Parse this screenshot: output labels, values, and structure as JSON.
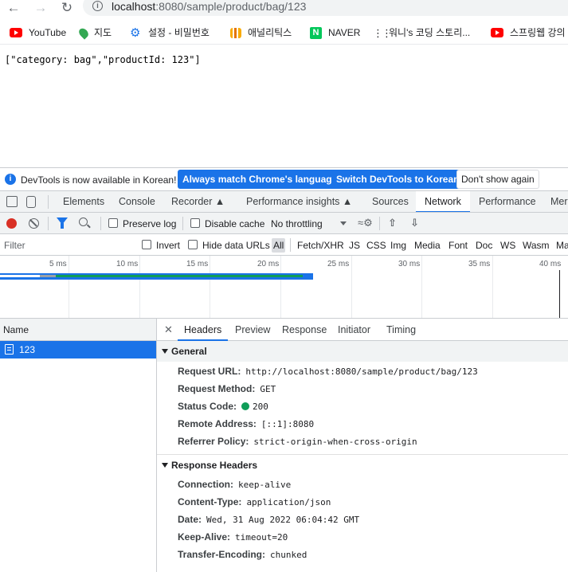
{
  "browser": {
    "url_host": "localhost",
    "url_path": ":8080/sample/product/bag/123"
  },
  "bookmarks": [
    {
      "label": "YouTube",
      "icon": "youtube-icon"
    },
    {
      "label": "지도",
      "icon": "maps-pin-icon"
    },
    {
      "label": "설정 - 비밀번호",
      "icon": "gear-icon"
    },
    {
      "label": "애널리틱스",
      "icon": "analytics-icon"
    },
    {
      "label": "NAVER",
      "icon": "naver-icon"
    },
    {
      "label": "워니's 코딩 스토리...",
      "icon": "dots-icon"
    },
    {
      "label": "스프링웹 강의",
      "icon": "youtube-icon"
    }
  ],
  "page": {
    "json_output": "[\"category: bag\",\"productId: 123\"]"
  },
  "devtools": {
    "infobar": {
      "message": "DevTools is now available in Korean!",
      "btn_match": "Always match Chrome's language",
      "btn_switch": "Switch DevTools to Korean",
      "btn_dismiss": "Don't show again"
    },
    "tabs": {
      "elements": "Elements",
      "console": "Console",
      "recorder": "Recorder",
      "performance_insights": "Performance insights",
      "sources": "Sources",
      "network": "Network",
      "performance": "Performance",
      "memory": "Mer"
    },
    "toolbar": {
      "preserve_log": "Preserve log",
      "disable_cache": "Disable cache",
      "throttling": "No throttling"
    },
    "filter": {
      "placeholder": "Filter",
      "invert": "Invert",
      "hide_data_urls": "Hide data URLs",
      "types": [
        "All",
        "Fetch/XHR",
        "JS",
        "CSS",
        "Img",
        "Media",
        "Font",
        "Doc",
        "WS",
        "Wasm",
        "Ma"
      ]
    },
    "timeline": {
      "ticks": [
        "5 ms",
        "10 ms",
        "15 ms",
        "20 ms",
        "25 ms",
        "30 ms",
        "35 ms",
        "40 ms"
      ]
    },
    "requests": {
      "name_header": "Name",
      "rows": [
        {
          "name": "123"
        }
      ]
    },
    "details": {
      "tabs": {
        "headers": "Headers",
        "preview": "Preview",
        "response": "Response",
        "initiator": "Initiator",
        "timing": "Timing"
      },
      "general": {
        "title": "General",
        "request_url_key": "Request URL:",
        "request_url": "http://localhost:8080/sample/product/bag/123",
        "request_method_key": "Request Method:",
        "request_method": "GET",
        "status_code_key": "Status Code:",
        "status_code": "200",
        "remote_address_key": "Remote Address:",
        "remote_address": "[::1]:8080",
        "referrer_policy_key": "Referrer Policy:",
        "referrer_policy": "strict-origin-when-cross-origin"
      },
      "response_headers": {
        "title": "Response Headers",
        "connection_key": "Connection:",
        "connection": "keep-alive",
        "content_type_key": "Content-Type:",
        "content_type": "application/json",
        "date_key": "Date:",
        "date": "Wed, 31 Aug 2022 06:04:42 GMT",
        "keep_alive_key": "Keep-Alive:",
        "keep_alive": "timeout=20",
        "transfer_encoding_key": "Transfer-Encoding:",
        "transfer_encoding": "chunked"
      }
    }
  },
  "colors": {
    "accent": "#1a73e8",
    "record": "#d93025",
    "status_ok": "#0f9d58"
  }
}
